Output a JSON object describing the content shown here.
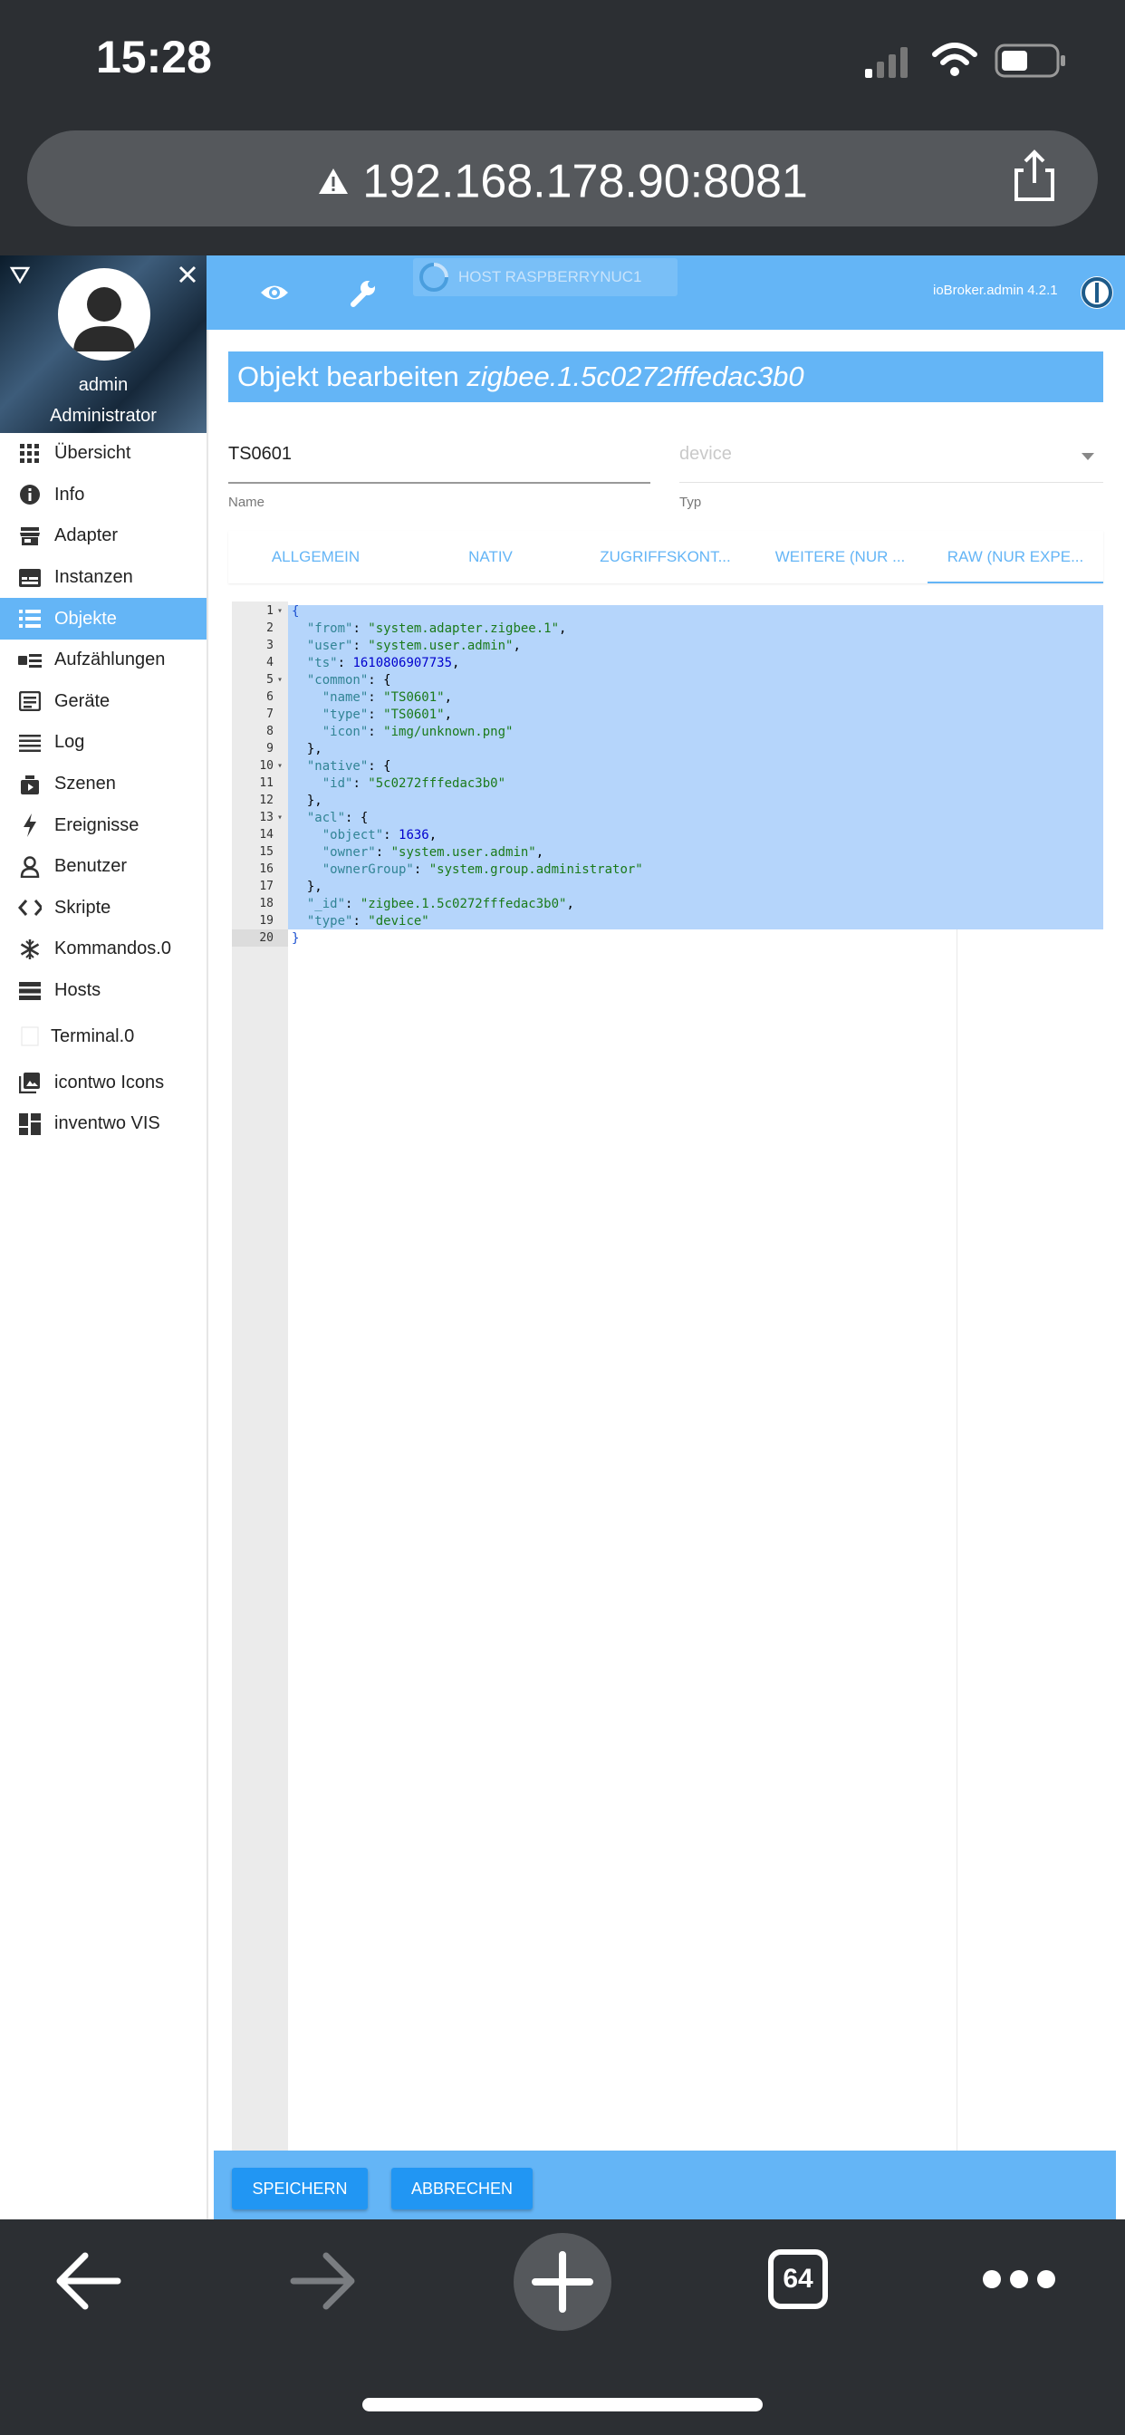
{
  "status": {
    "time": "15:28"
  },
  "browser": {
    "url": "192.168.178.90:8081",
    "tabs_count": "64"
  },
  "sidebar": {
    "user": "admin",
    "role": "Administrator",
    "items": [
      {
        "label": "Übersicht",
        "icon": "grid-icon"
      },
      {
        "label": "Info",
        "icon": "info-icon"
      },
      {
        "label": "Adapter",
        "icon": "store-icon"
      },
      {
        "label": "Instanzen",
        "icon": "instances-icon"
      },
      {
        "label": "Objekte",
        "icon": "list-icon",
        "active": true
      },
      {
        "label": "Aufzählungen",
        "icon": "enums-icon"
      },
      {
        "label": "Geräte",
        "icon": "devices-icon"
      },
      {
        "label": "Log",
        "icon": "log-icon"
      },
      {
        "label": "Szenen",
        "icon": "scenes-icon"
      },
      {
        "label": "Ereignisse",
        "icon": "bolt-icon"
      },
      {
        "label": "Benutzer",
        "icon": "user-icon"
      },
      {
        "label": "Skripte",
        "icon": "code-icon"
      },
      {
        "label": "Kommandos.0",
        "icon": "snowflake-icon"
      },
      {
        "label": "Hosts",
        "icon": "hosts-icon"
      },
      {
        "label": "Terminal.0",
        "icon": "blank-icon"
      },
      {
        "label": "icontwo Icons",
        "icon": "image-icon"
      },
      {
        "label": "inventwo VIS",
        "icon": "dashboard-icon"
      }
    ]
  },
  "toolbar": {
    "host": "HOST RASPBERRYNUC1",
    "brand": "ioBroker.admin 4.2.1"
  },
  "dialog": {
    "title_prefix": "Objekt bearbeiten",
    "title_id": "zigbee.1.5c0272fffedac3b0",
    "name_value": "TS0601",
    "name_label": "Name",
    "type_value": "device",
    "type_label": "Typ",
    "tabs": [
      "ALLGEMEIN",
      "NATIV",
      "ZUGRIFFSKONT...",
      "WEITERE (NUR ...",
      "RAW (NUR EXPE..."
    ],
    "active_tab": 4,
    "save_label": "SPEICHERN",
    "cancel_label": "ABBRECHEN"
  },
  "code_lines": [
    "{",
    "  \"from\": \"system.adapter.zigbee.1\",",
    "  \"user\": \"system.user.admin\",",
    "  \"ts\": 1610806907735,",
    "  \"common\": {",
    "    \"name\": \"TS0601\",",
    "    \"type\": \"TS0601\",",
    "    \"icon\": \"img/unknown.png\"",
    "  },",
    "  \"native\": {",
    "    \"id\": \"5c0272fffedac3b0\"",
    "  },",
    "  \"acl\": {",
    "    \"object\": 1636,",
    "    \"owner\": \"system.user.admin\",",
    "    \"ownerGroup\": \"system.group.administrator\"",
    "  },",
    "  \"_id\": \"zigbee.1.5c0272fffedac3b0\",",
    "  \"type\": \"device\"",
    "}"
  ],
  "fold_lines": [
    1,
    5,
    10,
    13
  ]
}
